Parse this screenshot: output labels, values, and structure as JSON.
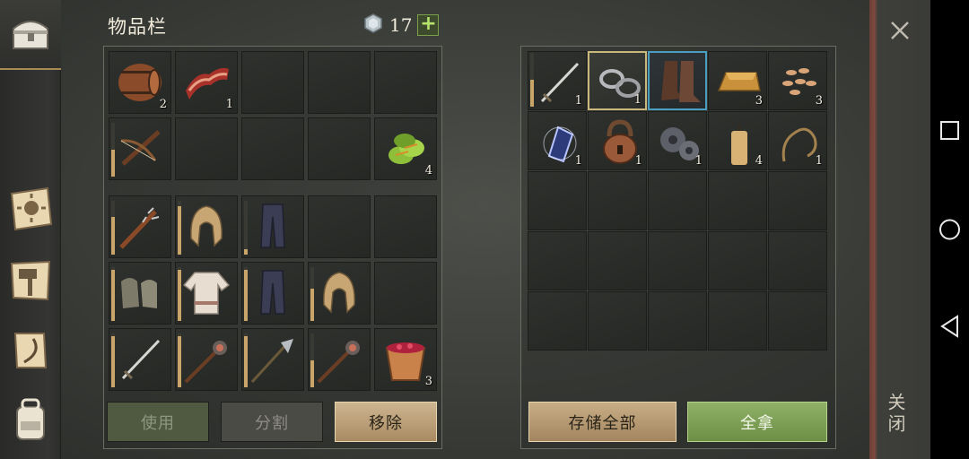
{
  "inventory": {
    "title": "物品栏",
    "gem_count": "17",
    "add_label": "+",
    "slots": [
      {
        "item": "barrel",
        "qty": "2"
      },
      {
        "item": "bacon",
        "qty": "1"
      },
      {
        "item": "",
        "qty": ""
      },
      {
        "item": "",
        "qty": ""
      },
      {
        "item": "",
        "qty": ""
      },
      {
        "item": "crossbow",
        "qty": "",
        "durability": 0.5
      },
      {
        "item": "",
        "qty": ""
      },
      {
        "item": "",
        "qty": ""
      },
      {
        "item": "",
        "qty": ""
      },
      {
        "item": "green-herbs",
        "qty": "4"
      }
    ],
    "equipment": [
      {
        "item": "spiked-club",
        "qty": "",
        "durability": 0.7
      },
      {
        "item": "hood",
        "qty": "",
        "durability": 0.9
      },
      {
        "item": "pants",
        "qty": "",
        "durability": 0.1
      },
      {
        "item": "",
        "qty": ""
      },
      {
        "item": "",
        "qty": ""
      },
      {
        "item": "gloves",
        "qty": "",
        "durability": 0.95
      },
      {
        "item": "shirt",
        "qty": "",
        "durability": 0.95
      },
      {
        "item": "pants",
        "qty": "",
        "durability": 0.95
      },
      {
        "item": "hood",
        "qty": "",
        "durability": 0.6
      },
      {
        "item": "",
        "qty": ""
      },
      {
        "item": "sword",
        "qty": "",
        "durability": 0.95
      },
      {
        "item": "mace",
        "qty": "",
        "durability": 0.95
      },
      {
        "item": "halberd",
        "qty": "",
        "durability": 0.95
      },
      {
        "item": "mace",
        "qty": "",
        "durability": 0.5
      },
      {
        "item": "berry-bucket",
        "qty": "3"
      }
    ],
    "buttons": {
      "use": "使用",
      "split": "分割",
      "remove": "移除"
    }
  },
  "chest": {
    "slots": [
      {
        "item": "sword",
        "qty": "1",
        "durability": 0.5
      },
      {
        "item": "chains",
        "qty": "1",
        "highlight": "gold"
      },
      {
        "item": "boots",
        "qty": "",
        "highlight": "blue"
      },
      {
        "item": "gold-ingot",
        "qty": "3"
      },
      {
        "item": "seeds",
        "qty": "3"
      },
      {
        "item": "crystal",
        "qty": "1"
      },
      {
        "item": "padlock",
        "qty": "1"
      },
      {
        "item": "gears",
        "qty": "1"
      },
      {
        "item": "candle",
        "qty": "4"
      },
      {
        "item": "rope",
        "qty": "1"
      }
    ],
    "rows": 6,
    "buttons": {
      "store_all": "存储全部",
      "take_all": "全拿"
    }
  },
  "close_label": "关闭",
  "sidebar": [
    "chest-icon",
    "sun-map-icon",
    "hammer-map-icon",
    "scroll-icon",
    "backpack-icon"
  ],
  "navbar": [
    "square-icon",
    "circle-icon",
    "back-triangle-icon"
  ],
  "colors": {
    "gold": "#c9a56a",
    "green": "#7aa04a",
    "cream": "#cdb591"
  }
}
